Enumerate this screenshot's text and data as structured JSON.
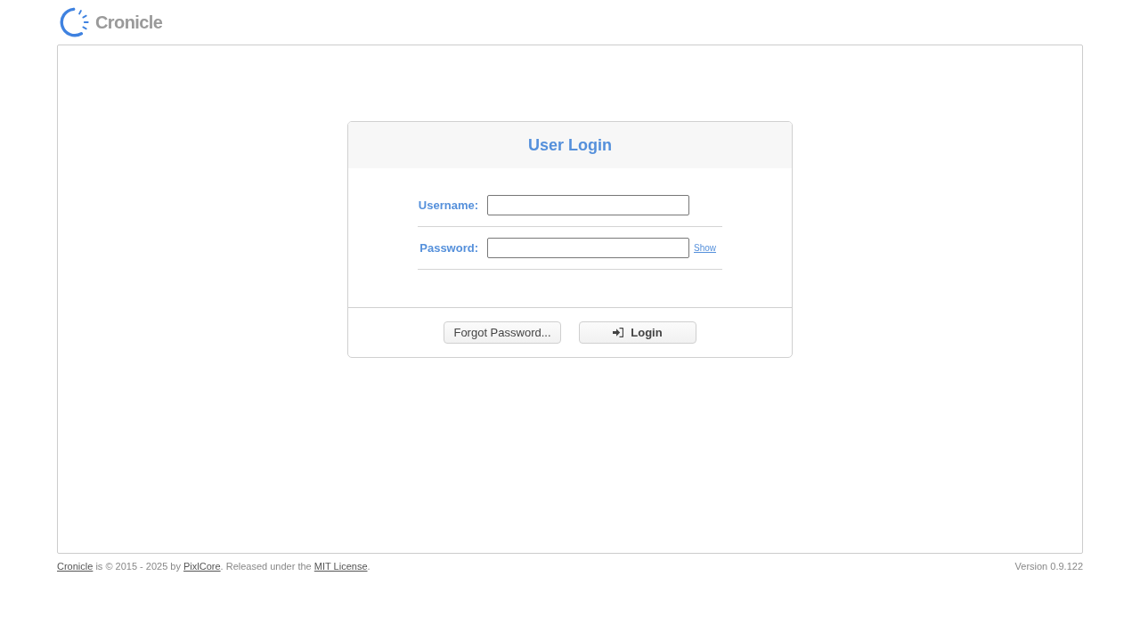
{
  "logo": {
    "text": "Cronicle"
  },
  "login_dialog": {
    "title": "User Login",
    "fields": [
      {
        "label": "Username:"
      },
      {
        "label": "Password:",
        "toggle": "Show"
      }
    ],
    "buttons": [
      {
        "kind": "secondary",
        "label": "Forgot Password..."
      },
      {
        "kind": "primary",
        "label": "Login"
      }
    ]
  },
  "footer": {
    "copyright": [
      {
        "kind": "link",
        "text": "Cronicle"
      },
      {
        "kind": "text",
        "text": " is © 2015 - 2025 by "
      },
      {
        "kind": "link",
        "text": "PixlCore"
      },
      {
        "kind": "text",
        "text": ". Released under the "
      },
      {
        "kind": "link",
        "text": "MIT License"
      },
      {
        "kind": "text",
        "text": "."
      }
    ],
    "version": "Version 0.9.122"
  }
}
